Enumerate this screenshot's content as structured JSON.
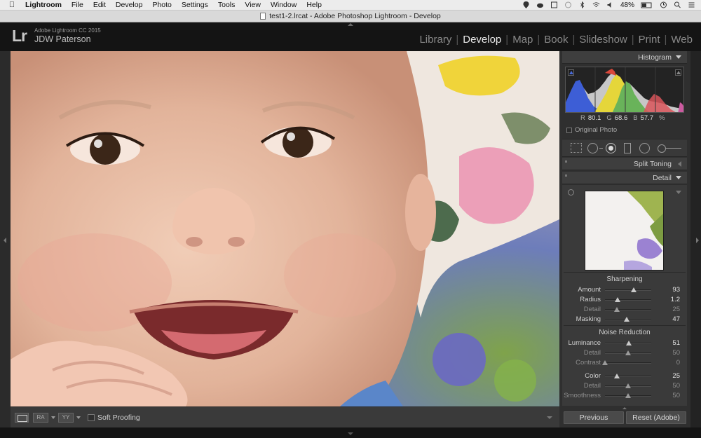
{
  "menubar": {
    "app": "Lightroom",
    "items": [
      "File",
      "Edit",
      "Develop",
      "Photo",
      "Settings",
      "Tools",
      "View",
      "Window",
      "Help"
    ],
    "battery": "48%"
  },
  "window": {
    "title": "test1-2.lrcat - Adobe Photoshop Lightroom - Develop"
  },
  "identity": {
    "logo": "Lr",
    "version": "Adobe Lightroom CC 2015",
    "user": "JDW Paterson"
  },
  "modules": [
    {
      "label": "Library",
      "active": false
    },
    {
      "label": "Develop",
      "active": true
    },
    {
      "label": "Map",
      "active": false
    },
    {
      "label": "Book",
      "active": false
    },
    {
      "label": "Slideshow",
      "active": false
    },
    {
      "label": "Print",
      "active": false
    },
    {
      "label": "Web",
      "active": false
    }
  ],
  "histogram": {
    "title": "Histogram",
    "r_label": "R",
    "r": "80.1",
    "g_label": "G",
    "g": "68.6",
    "b_label": "B",
    "b": "57.7",
    "unit": "%",
    "original_photo": "Original Photo"
  },
  "panels": {
    "split_toning": "Split Toning",
    "detail": "Detail"
  },
  "detail": {
    "sharpening": {
      "title": "Sharpening",
      "rows": [
        {
          "label": "Amount",
          "value": "93",
          "min": 0,
          "max": 150,
          "num": 93
        },
        {
          "label": "Radius",
          "value": "1.2",
          "min": 0.5,
          "max": 3.0,
          "num": 1.2
        },
        {
          "label": "Detail",
          "value": "25",
          "min": 0,
          "max": 100,
          "num": 25
        },
        {
          "label": "Masking",
          "value": "47",
          "min": 0,
          "max": 100,
          "num": 47
        }
      ]
    },
    "noise": {
      "title": "Noise Reduction",
      "rows": [
        {
          "label": "Luminance",
          "value": "51",
          "min": 0,
          "max": 100,
          "num": 51
        },
        {
          "label": "Detail",
          "value": "50",
          "min": 0,
          "max": 100,
          "num": 50
        },
        {
          "label": "Contrast",
          "value": "0",
          "min": 0,
          "max": 100,
          "num": 0
        },
        {
          "label": "Color",
          "value": "25",
          "min": 0,
          "max": 100,
          "num": 25
        },
        {
          "label": "Detail",
          "value": "50",
          "min": 0,
          "max": 100,
          "num": 50
        },
        {
          "label": "Smoothness",
          "value": "50",
          "min": 0,
          "max": 100,
          "num": 50
        }
      ]
    }
  },
  "buttons": {
    "previous": "Previous",
    "reset": "Reset (Adobe)"
  },
  "toolbar": {
    "soft_proofing": "Soft Proofing",
    "ra": "RA",
    "yy": "YY"
  },
  "icons": {
    "apple": "apple-icon",
    "wifi": "wifi-icon",
    "bluetooth": "bluetooth-icon",
    "volume": "volume-icon",
    "battery": "battery-icon",
    "search": "search-icon",
    "menu": "list-icon",
    "document": "document-icon"
  },
  "colors": {
    "accent": "#eaeaea",
    "panel": "#2f2f2f",
    "background": "#141414"
  }
}
